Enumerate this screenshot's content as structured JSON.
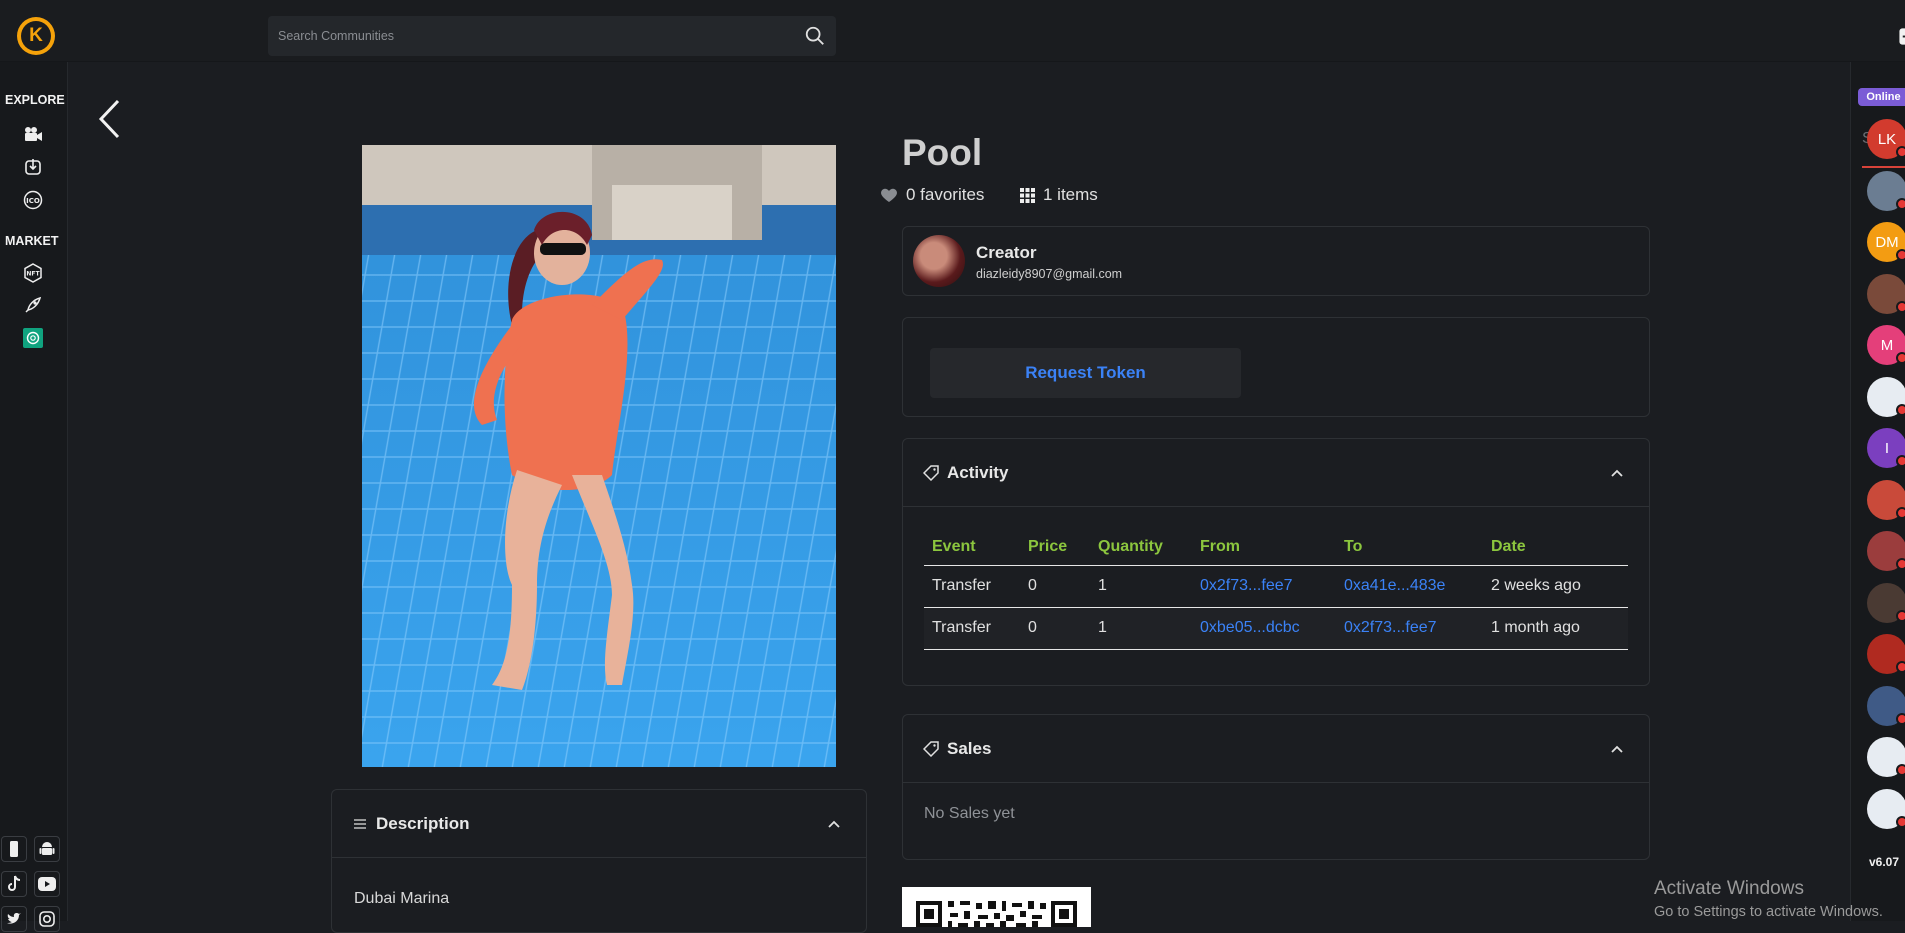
{
  "topbar": {
    "logo_letter": "K",
    "search_placeholder": "Search Communities"
  },
  "leftnav": {
    "explore_label": "EXPLORE",
    "market_label": "MARKET"
  },
  "rightnav": {
    "online_label": "Online",
    "search_placeholder": "Search",
    "avatars": [
      {
        "initials": "LK",
        "color": "#d23b2e"
      },
      {
        "initials": "",
        "color": "#6b7d92"
      },
      {
        "initials": "DM",
        "color": "#f39c12"
      },
      {
        "initials": "",
        "color": "#7a4a3a"
      },
      {
        "initials": "M",
        "color": "#e43f7a"
      },
      {
        "initials": "",
        "color": "#e7ecf2"
      },
      {
        "initials": "I",
        "color": "#7b3fbf"
      },
      {
        "initials": "",
        "color": "#c94a3a"
      },
      {
        "initials": "",
        "color": "#9b3d3d"
      },
      {
        "initials": "",
        "color": "#4a3a33"
      },
      {
        "initials": "",
        "color": "#b02a20"
      },
      {
        "initials": "",
        "color": "#3f5a86"
      },
      {
        "initials": "",
        "color": "#e7ecf2"
      },
      {
        "initials": "",
        "color": "#e7ecf2"
      }
    ],
    "version": "v6.07"
  },
  "item": {
    "title": "Pool",
    "favorites": "0 favorites",
    "items": "1 items"
  },
  "creator": {
    "label": "Creator",
    "email": "diazleidy8907@gmail.com"
  },
  "request_token_label": "Request Token",
  "activity": {
    "title": "Activity",
    "columns": [
      "Event",
      "Price",
      "Quantity",
      "From",
      "To",
      "Date"
    ],
    "rows": [
      {
        "event": "Transfer",
        "price": "0",
        "quantity": "1",
        "from": "0x2f73...fee7",
        "to": "0xa41e...483e",
        "date": "2 weeks ago"
      },
      {
        "event": "Transfer",
        "price": "0",
        "quantity": "1",
        "from": "0xbe05...dcbc",
        "to": "0x2f73...fee7",
        "date": "1 month ago"
      }
    ]
  },
  "sales": {
    "title": "Sales",
    "empty": "No Sales yet"
  },
  "description": {
    "title": "Description",
    "text": "Dubai Marina"
  },
  "windows": {
    "line1": "Activate Windows",
    "line2": "Go to Settings to activate Windows."
  }
}
